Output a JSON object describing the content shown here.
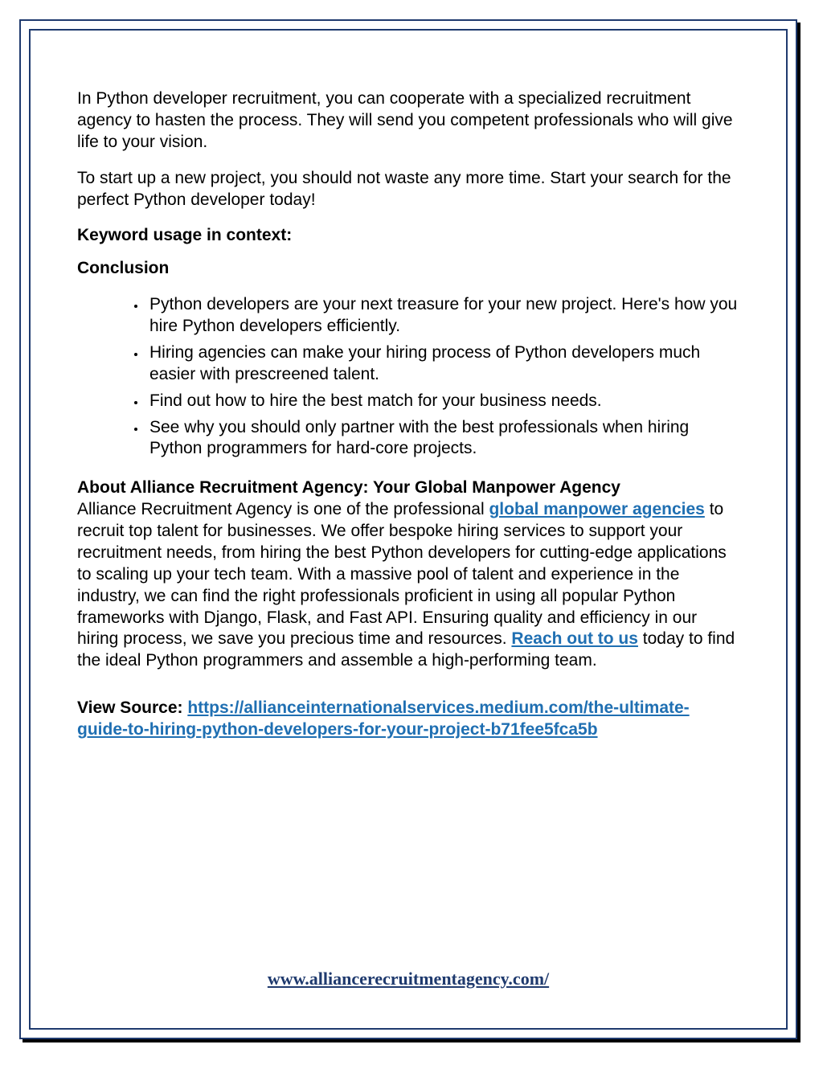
{
  "paragraphs": {
    "p1": "In Python developer recruitment, you can cooperate with a specialized recruitment agency to hasten the process. They will send you competent professionals who will give life to your vision.",
    "p2": "To start up a new project, you should not waste any more time. Start your search for the perfect Python developer today!",
    "keyword_heading": "Keyword usage in context:",
    "conclusion_heading": "Conclusion"
  },
  "bullets": [
    "Python developers are your next treasure for your new project. Here's how you hire Python developers efficiently.",
    "Hiring agencies can make your hiring process of Python developers much easier with prescreened talent.",
    "Find out how to hire the best match for your business needs.",
    "See why you should only partner with the best professionals when hiring Python programmers for hard-core projects."
  ],
  "about": {
    "heading": "About Alliance Recruitment Agency: Your Global Manpower Agency",
    "pre_link": "Alliance Recruitment Agency is one of the professional ",
    "link1_text": "global manpower agencies",
    "mid_a": " to recruit top talent for businesses. We offer bespoke hiring services to support your recruitment needs, from hiring the best Python developers for cutting-edge applications to scaling up your tech team. With a massive pool of talent and experience in the industry, we can find the right professionals proficient in using all popular Python frameworks with Django, Flask, and Fast API. Ensuring quality and efficiency in our hiring process, we save you precious time and resources. ",
    "link2_text": "Reach out to us",
    "mid_b": " today to find the ideal Python programmers and assemble a high-performing team."
  },
  "source": {
    "label": "View Source: ",
    "url": "https://allianceinternationalservices.medium.com/the-ultimate-guide-to-hiring-python-developers-for-your-project-b71fee5fca5b"
  },
  "footer": {
    "url": "www.alliancerecruitmentagency.com/"
  }
}
